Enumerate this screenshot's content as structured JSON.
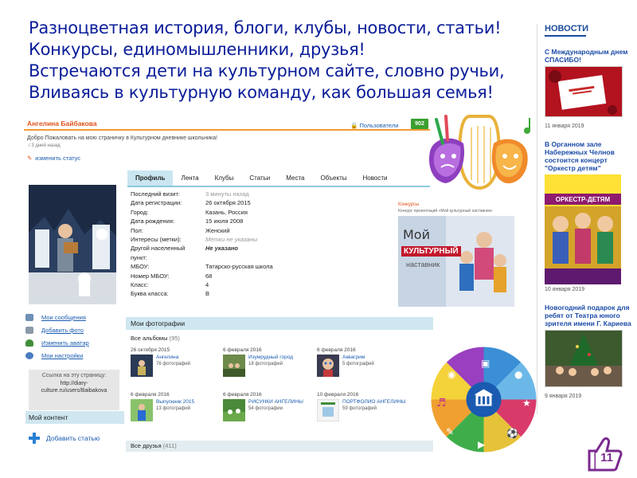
{
  "slide": {
    "lines": [
      "Разноцветная история, блоги, клубы, новости, статьи!",
      "Конкурсы, единомышленники, друзья!",
      "Встречаются дети на культурном сайте, словно ручьи,",
      "Вливаясь в культурную команду, как большая семья!"
    ],
    "text_color": "#0a1d99",
    "page_number": "11"
  },
  "news": {
    "header": "НОВОСТИ",
    "items": [
      {
        "title": "С Международным днем СПАСИБО!",
        "date": "11 января 2019",
        "image": "red-card-image"
      },
      {
        "title": "В Органном зале Набережных Челнов состоится концерт \"Оркестр детям\"",
        "date": "10 января 2019",
        "image": "orchestra-poster",
        "poster_title": "ОРКЕСТР-ДЕТЯМ"
      },
      {
        "title": "Новогодний подарок для ребят от Театра юного зрителя имени Г. Кариева",
        "date": "9 января 2019",
        "image": "theater-photo"
      }
    ]
  },
  "site": {
    "user_name": "Ангелина Байбакова",
    "welcome": "Добро Пожаловать на мою страничку в Культурном дневнике школьника!",
    "status_date": "/ 3 дней назад",
    "change_status": "изменить статус",
    "users_link": "Пользователи",
    "users_count": "902",
    "tabs": [
      "Профиль",
      "Лента",
      "Клубы",
      "Статьи",
      "Места",
      "Объекты",
      "Новости"
    ],
    "active_tab": "Профиль",
    "profile": [
      {
        "k": "Последний визит:",
        "v": "3 минуты назад",
        "style": "muted"
      },
      {
        "k": "Дата регистрации:",
        "v": "26 октября 2015",
        "style": ""
      },
      {
        "k": "Город:",
        "v": "Казань, Россия",
        "style": ""
      },
      {
        "k": "Дата рождения:",
        "v": "15 июля 2008",
        "style": ""
      },
      {
        "k": "Пол:",
        "v": "Женский",
        "style": ""
      },
      {
        "k": "Интересы (метки):",
        "v": "Метки не указаны",
        "style": "ital"
      },
      {
        "k": "Другой населенный",
        "v": "Не указано",
        "style": "bold"
      },
      {
        "k": "пункт:",
        "v": "",
        "style": ""
      },
      {
        "k": "МБОУ:",
        "v": "Татарско-русская школа",
        "style": ""
      },
      {
        "k": "Номер МБОУ:",
        "v": "68",
        "style": ""
      },
      {
        "k": "Класс:",
        "v": "4",
        "style": ""
      },
      {
        "k": "Буква класса:",
        "v": "В",
        "style": ""
      }
    ],
    "left_links": [
      {
        "label": "Мои сообщения",
        "icon": "envelope-icon",
        "color": "#6e8fb5"
      },
      {
        "label": "Добавить фото",
        "icon": "camera-icon",
        "color": "#8a9aa8"
      },
      {
        "label": "Изменить аватар",
        "icon": "user-icon",
        "color": "#3f8f3a"
      },
      {
        "label": "Мои настройки",
        "icon": "gear-icon",
        "color": "#4b7cc0"
      }
    ],
    "link_box": {
      "label": "Ссылка на эту страницу:",
      "url_1": "http://diary-",
      "url_2": "culture.ru/users/Baibakova"
    },
    "my_content": "Мой контент",
    "add_article": "Добавить статью",
    "photos_header": "Мои фотографии",
    "all_albums": "Все альбомы",
    "albums_count": "(95)",
    "albums": [
      {
        "date": "26 октября 2015",
        "title": "Ангелина",
        "count": "76 фотографий"
      },
      {
        "date": "6 февраля 2016",
        "title": "Изумрудный город",
        "count": "18 фотографий"
      },
      {
        "date": "6 февраля 2016",
        "title": "Аквагрим",
        "count": "5 фотографий"
      },
      {
        "date": "6 февраля 2016",
        "title": "Выпускник 2015",
        "count": "13 фотографий"
      },
      {
        "date": "6 февраля 2016",
        "title": "РИСУНКИ АНГЕЛИНЫ",
        "count": "54 фотографии"
      },
      {
        "date": "10 февраля 2016",
        "title": "ПОРТФОЛИО АНГЕЛИНЫ",
        "count": "59 фотографий"
      }
    ],
    "friends_header": "Все друзья",
    "friends_count": "(411)",
    "contests": {
      "header": "Конкурсы",
      "sub": "Конкурс презентаций «Мой культурный наставник»",
      "img_word1": "Мой",
      "img_word2": "КУЛЬТУРНЫЙ",
      "img_word3": "наставник"
    }
  },
  "colors": {
    "accent_orange": "#f39a33",
    "link_blue": "#1a5cb0",
    "tab_active": "#c9e6f1",
    "badge_green": "#3a9f2f"
  }
}
